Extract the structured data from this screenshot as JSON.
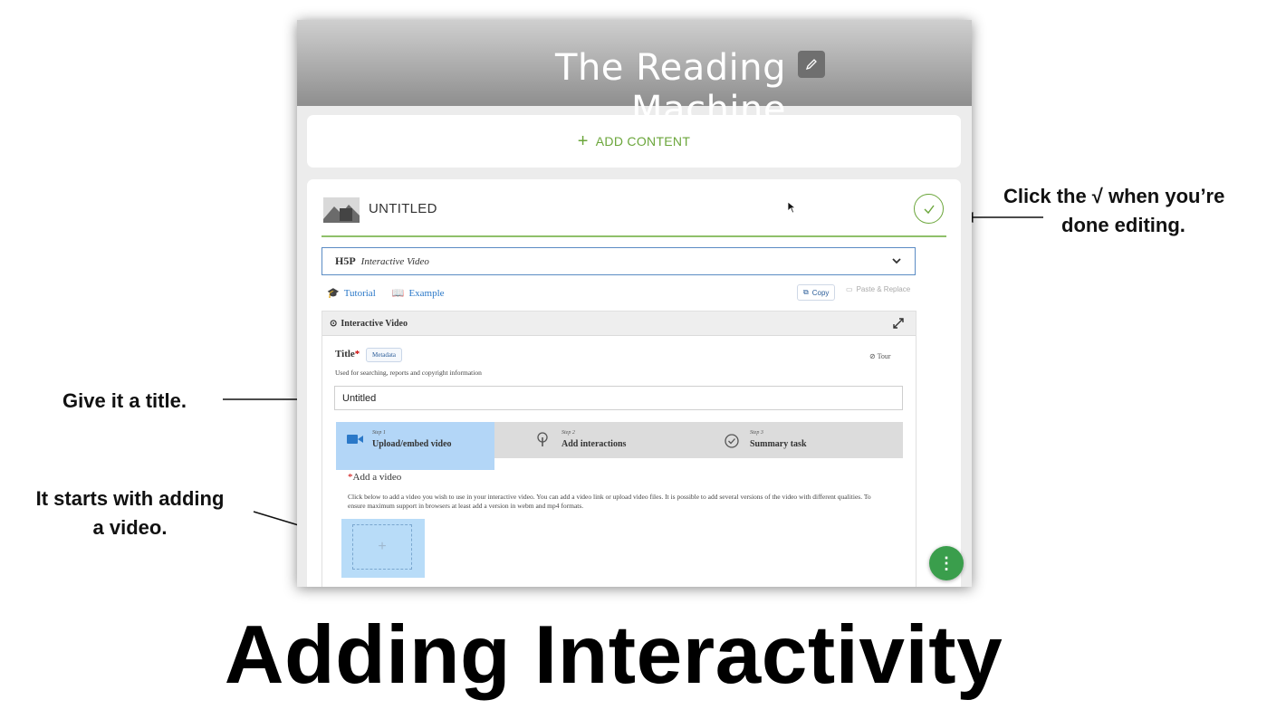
{
  "window": {
    "title": "The Reading Machine",
    "add_content": "ADD CONTENT",
    "card": {
      "name": "UNTITLED",
      "content_type": "Interactive Video",
      "h5p_logo": "H5P",
      "tutorial": "Tutorial",
      "example": "Example",
      "copy": "Copy",
      "paste_replace": "Paste & Replace",
      "panel_title": "Interactive Video",
      "title_label": "Title",
      "required_mark": "*",
      "metadata": "Metadata",
      "tour": "Tour",
      "title_description": "Used for searching, reports and copyright information",
      "title_value": "Untitled",
      "steps": [
        {
          "num": "Step 1",
          "label": "Upload/embed video",
          "icon": "video-camera-icon"
        },
        {
          "num": "Step 2",
          "label": "Add interactions",
          "icon": "touch-icon"
        },
        {
          "num": "Step 3",
          "label": "Summary task",
          "icon": "check-circle-icon"
        }
      ],
      "add_video_label": "Add a video",
      "add_video_description": "Click below to add a video you wish to use in your interactive video. You can add a video link or upload video files. It is possible to add several versions of the video with different qualities. To ensure maximum support in browsers at least add a version in webm and mp4 formats.",
      "add_icon": "+"
    }
  },
  "annotations": {
    "done_line1": "Click the √ when you’re",
    "done_line2": "done editing.",
    "title_note": "Give it a title.",
    "video_line1": "It starts with adding",
    "video_line2": "a video."
  },
  "slide_title": "Adding Interactivity",
  "colors": {
    "accent_green": "#6ba63b",
    "link_blue": "#2a78c8",
    "active_step": "#b3d6f7",
    "fab_green": "#3a9e4c"
  }
}
